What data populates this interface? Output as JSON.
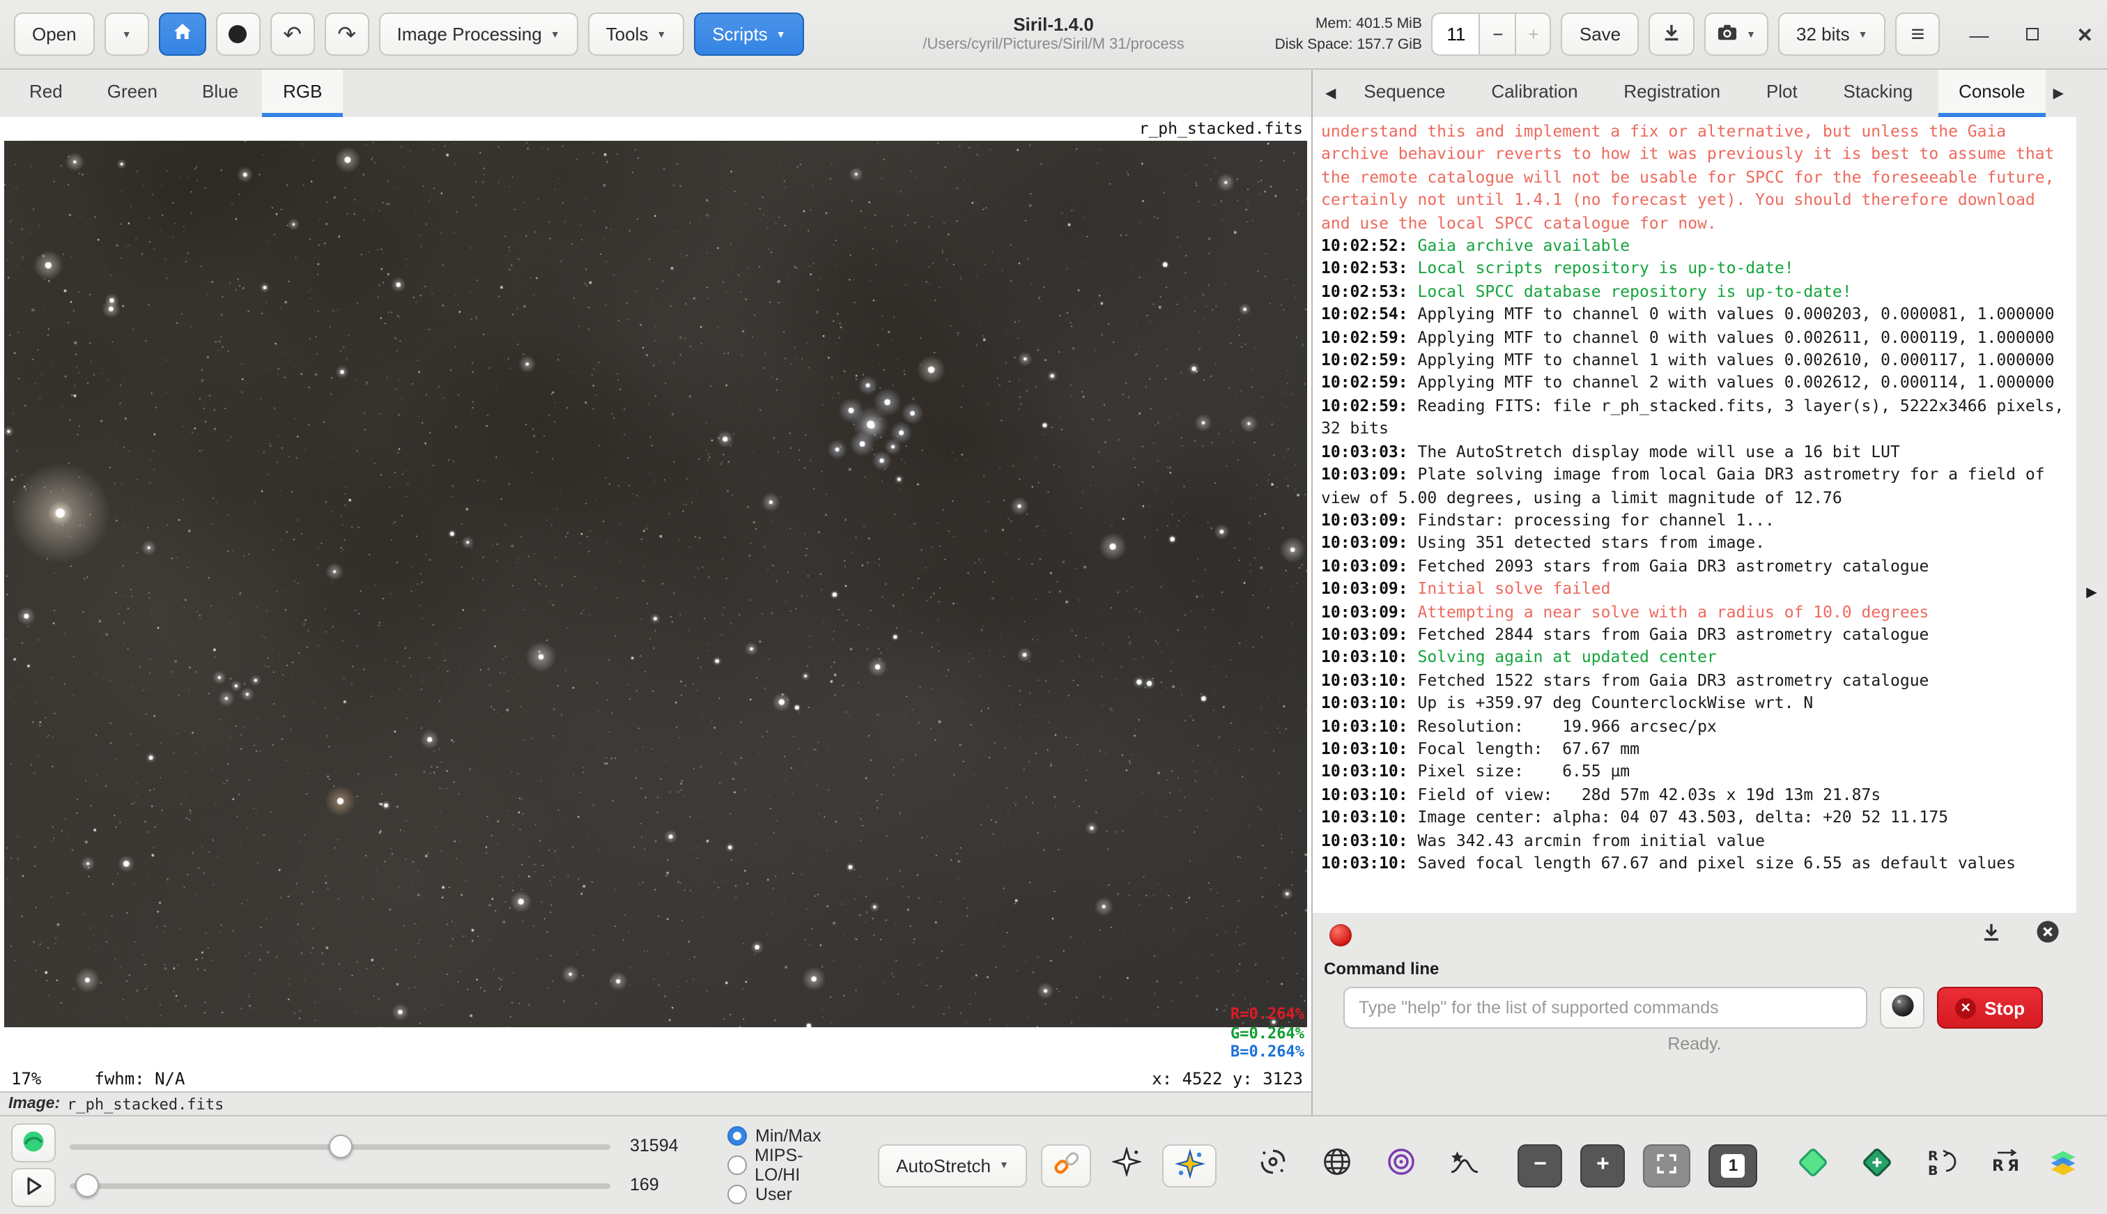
{
  "colors": {
    "accent": "#3584e4",
    "console_green": "#14a43c",
    "console_red": "#ec6a5e",
    "stop_red": "#d61a22",
    "r_text": "#e01b24",
    "g_text": "#109e32",
    "b_text": "#1c71d8"
  },
  "glyphs": {
    "caret_down": "▼",
    "undo": "↶",
    "redo": "↷",
    "hamburger": "≡",
    "minimize": "—",
    "close": "✕",
    "minus": "−",
    "plus": "+",
    "tab_prev": "◀",
    "tab_next": "▶",
    "collapse": "▶",
    "zoom_out": "−",
    "zoom_in": "+",
    "zoom_one": "1",
    "stop_x": "✕"
  },
  "titlebar": {
    "open": "Open",
    "image_processing": "Image Processing",
    "tools": "Tools",
    "scripts": "Scripts",
    "title": "Siril-1.4.0",
    "path": "/Users/cyril/Pictures/Siril/M 31/process",
    "mem": "Mem: 401.5 MiB",
    "disk": "Disk Space: 157.7 GiB",
    "spin_value": "11",
    "save": "Save",
    "bit_depth": "32 bits"
  },
  "channel_tabs": {
    "red": "Red",
    "green": "Green",
    "blue": "Blue",
    "rgb": "RGB"
  },
  "image_area": {
    "filename": "r_ph_stacked.fits",
    "zoom_level": "17%",
    "fwhm": "fwhm: N/A",
    "cursor_coords": "x: 4522 y: 3123",
    "r_value": "R=0.264%",
    "g_value": "G=0.264%",
    "b_value": "B=0.264%",
    "label_prefix": "Image:",
    "image_name": "r_ph_stacked.fits"
  },
  "right_panel": {
    "tabs": {
      "sequence": "Sequence",
      "calibration": "Calibration",
      "registration": "Registration",
      "plot": "Plot",
      "stacking": "Stacking",
      "console": "Console"
    },
    "command_line_label": "Command line",
    "command_placeholder": "Type \"help\" for the list of supported commands",
    "stop": "Stop",
    "ready": "Ready.",
    "console_lines": [
      {
        "t": "",
        "m": "understand this and implement a fix or alternative, but unless the Gaia archive behaviour reverts to how it was previously it is best to assume that the remote catalogue will not be usable for SPCC for the foreseeable future, certainly not until 1.4.1 (no forecast yet). You should therefore download and use the local SPCC catalogue for now.",
        "c": "r"
      },
      {
        "t": "10:02:52: ",
        "m": "Gaia archive available",
        "c": "g"
      },
      {
        "t": "10:02:53: ",
        "m": "Local scripts repository is up-to-date!",
        "c": "g"
      },
      {
        "t": "10:02:53: ",
        "m": "Local SPCC database repository is up-to-date!",
        "c": "g"
      },
      {
        "t": "10:02:54: ",
        "m": "Applying MTF to channel 0 with values 0.000203, 0.000081, 1.000000",
        "c": "d"
      },
      {
        "t": "10:02:59: ",
        "m": "Applying MTF to channel 0 with values 0.002611, 0.000119, 1.000000",
        "c": "d"
      },
      {
        "t": "10:02:59: ",
        "m": "Applying MTF to channel 1 with values 0.002610, 0.000117, 1.000000",
        "c": "d"
      },
      {
        "t": "10:02:59: ",
        "m": "Applying MTF to channel 2 with values 0.002612, 0.000114, 1.000000",
        "c": "d"
      },
      {
        "t": "10:02:59: ",
        "m": "Reading FITS: file r_ph_stacked.fits, 3 layer(s), 5222x3466 pixels, 32 bits",
        "c": "d"
      },
      {
        "t": "10:03:03: ",
        "m": "The AutoStretch display mode will use a 16 bit LUT",
        "c": "d"
      },
      {
        "t": "10:03:09: ",
        "m": "Plate solving image from local Gaia DR3 astrometry for a field of view of 5.00 degrees, using a limit magnitude of 12.76",
        "c": "d"
      },
      {
        "t": "10:03:09: ",
        "m": "Findstar: processing for channel 1...",
        "c": "d"
      },
      {
        "t": "10:03:09: ",
        "m": "Using 351 detected stars from image.",
        "c": "d"
      },
      {
        "t": "10:03:09: ",
        "m": "Fetched 2093 stars from Gaia DR3 astrometry catalogue",
        "c": "d"
      },
      {
        "t": "10:03:09: ",
        "m": "Initial solve failed",
        "c": "r"
      },
      {
        "t": "10:03:09: ",
        "m": "Attempting a near solve with a radius of 10.0 degrees",
        "c": "r"
      },
      {
        "t": "10:03:09: ",
        "m": "Fetched 2844 stars from Gaia DR3 astrometry catalogue",
        "c": "d"
      },
      {
        "t": "10:03:10: ",
        "m": "Solving again at updated center",
        "c": "g"
      },
      {
        "t": "10:03:10: ",
        "m": "Fetched 1522 stars from Gaia DR3 astrometry catalogue",
        "c": "d"
      },
      {
        "t": "10:03:10: ",
        "m": "Up is +359.97 deg CounterclockWise wrt. N",
        "c": "d"
      },
      {
        "t": "10:03:10: ",
        "m": "Resolution:    19.966 arcsec/px",
        "c": "d"
      },
      {
        "t": "10:03:10: ",
        "m": "Focal length:  67.67 mm",
        "c": "d"
      },
      {
        "t": "10:03:10: ",
        "m": "Pixel size:    6.55 µm",
        "c": "d"
      },
      {
        "t": "10:03:10: ",
        "m": "Field of view:   28d 57m 42.03s x 19d 13m 21.87s",
        "c": "d"
      },
      {
        "t": "10:03:10: ",
        "m": "Image center: alpha: 04 07 43.503, delta: +20 52 11.175",
        "c": "d"
      },
      {
        "t": "10:03:10: ",
        "m": "Was 342.43 arcmin from initial value",
        "c": "d"
      },
      {
        "t": "10:03:10: ",
        "m": "Saved focal length 67.67 and pixel size 6.55 as default values",
        "c": "d"
      }
    ]
  },
  "bottom_bar": {
    "high_value": "31594",
    "low_value": "169",
    "mode_minmax": "Min/Max",
    "mode_mips": "MIPS-LO/HI",
    "mode_user": "User",
    "stretch_mode": "AutoStretch"
  }
}
